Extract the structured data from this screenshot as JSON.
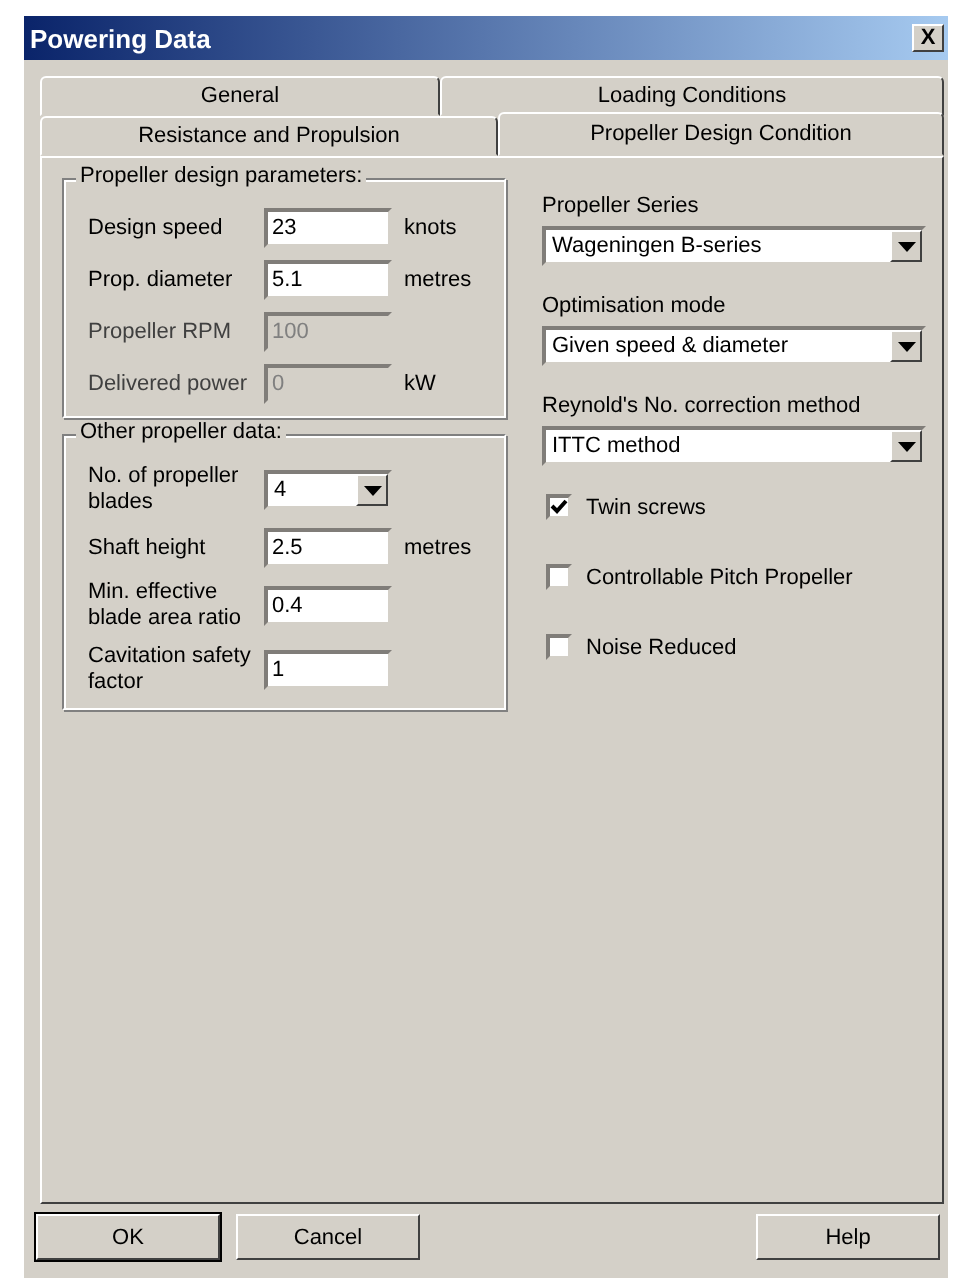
{
  "window": {
    "title": "Powering Data",
    "close": "X"
  },
  "tab_rows": [
    [
      {
        "label": "General",
        "selected": false
      },
      {
        "label": "Loading Conditions",
        "selected": false
      }
    ],
    [
      {
        "label": "Resistance and Propulsion",
        "selected": false
      },
      {
        "label": "Propeller Design Condition",
        "selected": true
      }
    ]
  ],
  "groups": [
    {
      "title": "Propeller design parameters:",
      "fields": [
        {
          "kind": "text",
          "label": "Design speed",
          "value": "23",
          "unit": "knots",
          "disabled": false
        },
        {
          "kind": "text",
          "label": "Prop. diameter",
          "value": "5.1",
          "unit": "metres",
          "disabled": false
        },
        {
          "kind": "text",
          "label": "Propeller RPM",
          "value": "100",
          "disabled": true
        },
        {
          "kind": "text",
          "label": "Delivered power",
          "value": "0",
          "unit": "kW",
          "disabled": true
        }
      ]
    },
    {
      "title": "Other propeller data:",
      "fields": [
        {
          "kind": "dropdown",
          "label": "No. of propeller blades",
          "value": "4"
        },
        {
          "kind": "text",
          "label": "Shaft height",
          "value": "2.5",
          "unit": "metres",
          "disabled": false
        },
        {
          "kind": "text",
          "label": "Min. effective blade area ratio",
          "value": "0.4",
          "disabled": false
        },
        {
          "kind": "text",
          "label": "Cavitation safety factor",
          "value": "1",
          "disabled": false
        }
      ]
    }
  ],
  "selects": [
    {
      "label": "Propeller Series",
      "value": "Wageningen B-series"
    },
    {
      "label": "Optimisation mode",
      "value": "Given speed & diameter"
    },
    {
      "label": "Reynold's No. correction method",
      "value": "ITTC method"
    }
  ],
  "checkboxes": [
    {
      "label": "Twin screws",
      "checked": true
    },
    {
      "label": "Controllable Pitch Propeller",
      "checked": false
    },
    {
      "label": "Noise Reduced",
      "checked": false
    }
  ],
  "buttons": [
    {
      "label": "OK",
      "default": true
    },
    {
      "label": "Cancel",
      "default": false
    },
    {
      "label": "Help",
      "default": false
    }
  ]
}
